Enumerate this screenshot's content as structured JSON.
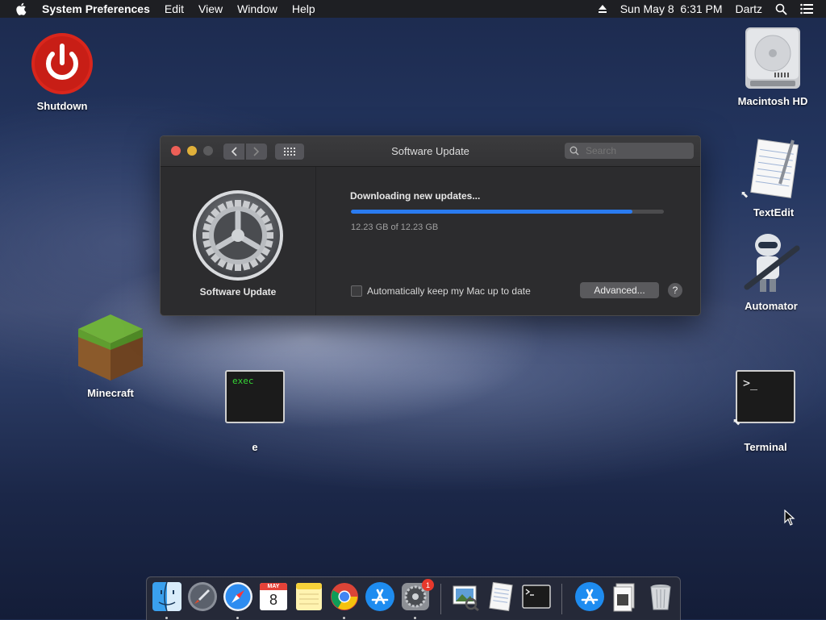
{
  "menubar": {
    "app_name": "System Preferences",
    "items": [
      "Edit",
      "View",
      "Window",
      "Help"
    ],
    "datetime": "Sun May 8  6:31 PM",
    "user": "Dartz"
  },
  "desktop": {
    "shutdown": "Shutdown",
    "macintosh_hd": "Macintosh HD",
    "textedit": "TextEdit",
    "automator": "Automator",
    "minecraft": "Minecraft",
    "exec_file": "e",
    "exec_tag": "exec",
    "terminal": "Terminal",
    "terminal_prompt": ">_"
  },
  "window": {
    "title": "Software Update",
    "search_placeholder": "Search",
    "pane_caption": "Software Update",
    "status": "Downloading new updates...",
    "progress_fraction": 0.9,
    "size_text": "12.23 GB of 12.23 GB",
    "auto_update_label": "Automatically keep my Mac up to date",
    "advanced_label": "Advanced...",
    "help_label": "?"
  },
  "dock": {
    "calendar_month": "MAY",
    "calendar_day": "8",
    "prefs_badge": "1"
  },
  "colors": {
    "accent": "#2a7bf0",
    "shutdown_red": "#d9261c"
  }
}
